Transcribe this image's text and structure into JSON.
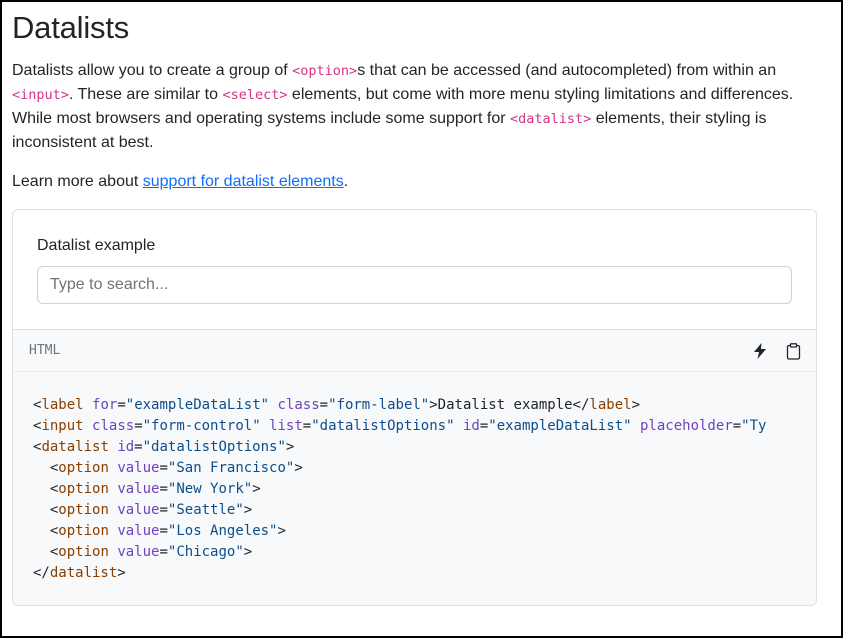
{
  "page": {
    "title": "Datalists",
    "intro": {
      "t1": "Datalists allow you to create a group of ",
      "code1": "<option>",
      "t2": "s that can be accessed (and autocompleted) from within an ",
      "code2": "<input>",
      "t3": ". These are similar to ",
      "code3": "<select>",
      "t4": " elements, but come with more menu styling limitations and differences. While most browsers and operating systems include some support for ",
      "code4": "<datalist>",
      "t5": " elements, their styling is inconsistent at best."
    },
    "learn": {
      "prefix": "Learn more about ",
      "link": "support for datalist elements",
      "suffix": "."
    }
  },
  "example": {
    "label": "Datalist example",
    "placeholder": "Type to search..."
  },
  "code_header": {
    "language": "HTML",
    "stackblitz_icon": "lightning-icon",
    "copy_icon": "clipboard-icon"
  },
  "code": {
    "l1": {
      "open": "<",
      "tag": "label",
      "sp1": " ",
      "a1": "for",
      "eq1": "=",
      "v1": "\"exampleDataList\"",
      "sp2": " ",
      "a2": "class",
      "eq2": "=",
      "v2": "\"form-label\"",
      "text": ">Datalist example</",
      "ctag": "label",
      "close": ">"
    },
    "l2": {
      "open": "<",
      "tag": "input",
      "sp1": " ",
      "a1": "class",
      "eq1": "=",
      "v1": "\"form-control\"",
      "sp2": " ",
      "a2": "list",
      "eq2": "=",
      "v2": "\"datalistOptions\"",
      "sp3": " ",
      "a3": "id",
      "eq3": "=",
      "v3": "\"exampleDataList\"",
      "sp4": " ",
      "a4": "placeholder",
      "eq4": "=",
      "v4": "\"Ty"
    },
    "l3": {
      "open": "<",
      "tag": "datalist",
      "sp1": " ",
      "a1": "id",
      "eq1": "=",
      "v1": "\"datalistOptions\"",
      "close": ">"
    },
    "options": [
      {
        "indent": "  ",
        "open": "<",
        "tag": "option",
        "sp": " ",
        "attr": "value",
        "eq": "=",
        "val": "\"San Francisco\"",
        "close": ">"
      },
      {
        "indent": "  ",
        "open": "<",
        "tag": "option",
        "sp": " ",
        "attr": "value",
        "eq": "=",
        "val": "\"New York\"",
        "close": ">"
      },
      {
        "indent": "  ",
        "open": "<",
        "tag": "option",
        "sp": " ",
        "attr": "value",
        "eq": "=",
        "val": "\"Seattle\"",
        "close": ">"
      },
      {
        "indent": "  ",
        "open": "<",
        "tag": "option",
        "sp": " ",
        "attr": "value",
        "eq": "=",
        "val": "\"Los Angeles\"",
        "close": ">"
      },
      {
        "indent": "  ",
        "open": "<",
        "tag": "option",
        "sp": " ",
        "attr": "value",
        "eq": "=",
        "val": "\"Chicago\"",
        "close": ">"
      }
    ],
    "l9": {
      "open": "</",
      "tag": "datalist",
      "close": ">"
    }
  },
  "colors": {
    "link": "#0d6efd",
    "inline_code": "#d63384",
    "code_tag": "#8a3f00",
    "code_attr": "#6f42c1",
    "code_string": "#0c4e8c",
    "code_bg": "#f8f9fa"
  }
}
